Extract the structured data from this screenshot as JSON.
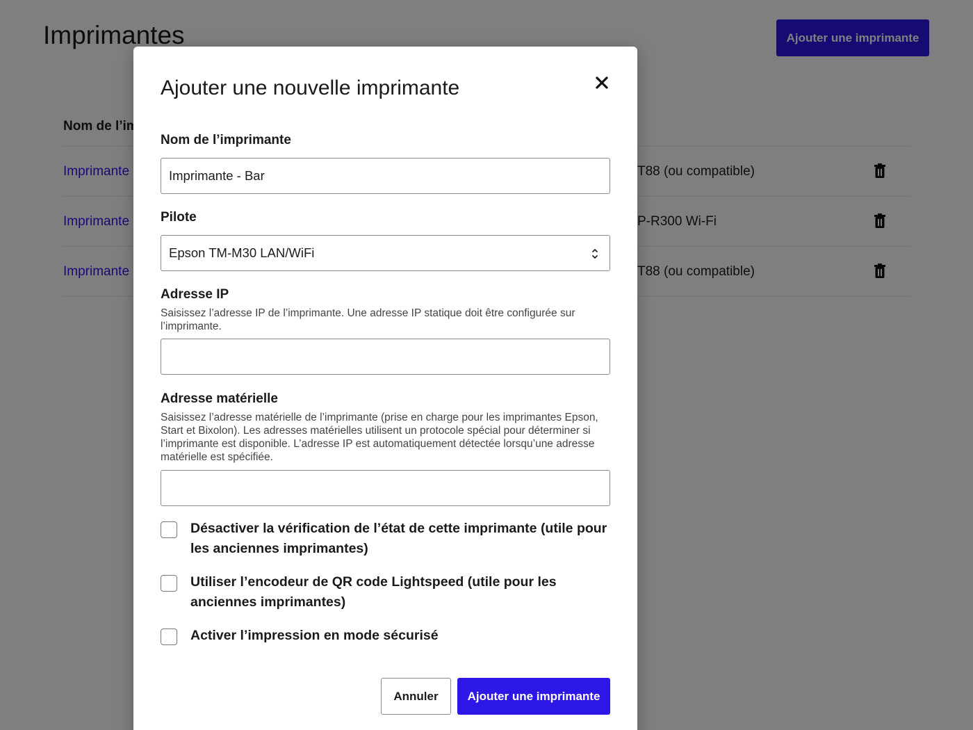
{
  "page": {
    "title": "Imprimantes",
    "add_button": "Ajouter une imprimante",
    "table": {
      "header_name": "Nom de l’im",
      "rows": [
        {
          "name": "Imprimante",
          "driver": "T88 (ou compatible)"
        },
        {
          "name": "Imprimante",
          "driver": "P-R300 Wi-Fi"
        },
        {
          "name": "Imprimante",
          "driver": "T88 (ou compatible)"
        }
      ]
    }
  },
  "modal": {
    "title": "Ajouter une nouvelle imprimante",
    "name_label": "Nom de l’imprimante",
    "name_value": "Imprimante - Bar",
    "driver_label": "Pilote",
    "driver_value": "Epson TM-M30 LAN/WiFi",
    "ip_label": "Adresse IP",
    "ip_help": "Saisissez l’adresse IP de l’imprimante. Une adresse IP statique doit être configurée sur l’imprimante.",
    "ip_value": "",
    "mac_label": "Adresse matérielle",
    "mac_help": "Saisissez l’adresse matérielle de l’imprimante (prise en charge pour les imprimantes Epson, Start et Bixolon). Les adresses matérielles utilisent un protocole spécial pour déterminer si l’imprimante est disponible. L’adresse IP est automatiquement détectée lorsqu’une adresse matérielle est spécifiée.",
    "mac_value": "",
    "checkboxes": [
      {
        "label": "Désactiver la vérification de l’état de cette imprimante (utile pour les anciennes imprimantes)",
        "checked": false
      },
      {
        "label": "Utiliser l’encodeur de QR code Lightspeed (utile pour les anciennes imprimantes)",
        "checked": false
      },
      {
        "label": "Activer l’impression en mode sécurisé",
        "checked": false
      }
    ],
    "cancel_label": "Annuler",
    "submit_label": "Ajouter une imprimante"
  },
  "icons": {
    "delete": "trash-icon",
    "close": "close-icon",
    "select": "chevron-updown-icon"
  },
  "colors": {
    "primary": "#2d17e6",
    "overlay": "rgba(0,0,0,0.5)"
  }
}
